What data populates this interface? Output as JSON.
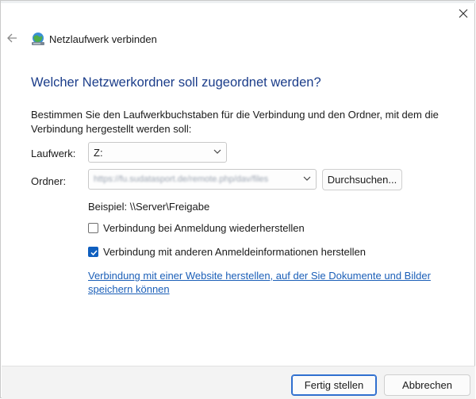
{
  "wizard": {
    "title": "Netzlaufwerk verbinden",
    "heading": "Welcher Netzwerkordner soll zugeordnet werden?",
    "description": "Bestimmen Sie den Laufwerkbuchstaben für die Verbindung und den Ordner, mit dem die Verbindung hergestellt werden soll:"
  },
  "form": {
    "drive_label": "Laufwerk:",
    "drive_value": "Z:",
    "folder_label": "Ordner:",
    "folder_value": "https://fu.sudatasport.de/remote.php/dav/files",
    "browse_label": "Durchsuchen...",
    "example": "Beispiel: \\\\Server\\Freigabe"
  },
  "options": [
    {
      "label": "Verbindung bei Anmeldung wiederherstellen",
      "checked": false
    },
    {
      "label": "Verbindung mit anderen Anmeldeinformationen herstellen",
      "checked": true
    }
  ],
  "link": {
    "text": "Verbindung mit einer Website herstellen, auf der Sie Dokumente und Bilder speichern können"
  },
  "footer": {
    "finish_label": "Fertig stellen",
    "cancel_label": "Abbrechen"
  },
  "icons": {
    "close": "close-icon",
    "back": "back-arrow-icon",
    "wizard": "network-drive-icon",
    "dropdown": "chevron-down-icon",
    "check": "checkmark-icon"
  },
  "colors": {
    "heading": "#1b3d8a",
    "link": "#1b5fb8",
    "checkbox_accent": "#0f5fbf",
    "footer_bg": "#f3f3f3"
  }
}
